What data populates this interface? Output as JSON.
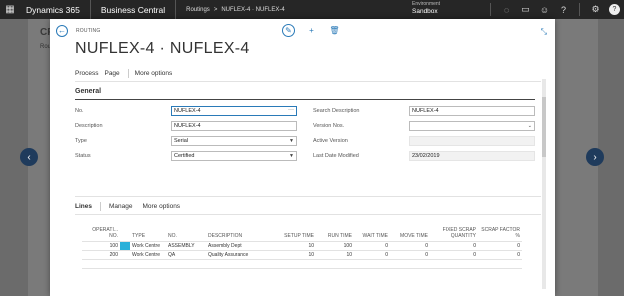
{
  "topbar": {
    "brand": "Dynamics 365",
    "app": "Business Central",
    "breadcrumb": [
      "Routings",
      ">",
      "NUFLEX-4 · NUFLEX-4"
    ],
    "environment_label": "Environment",
    "environment_value": "Sandbox",
    "icons": [
      "lightbulb-icon",
      "chat-icon",
      "smiley-icon",
      "help-icon",
      "settings-icon"
    ],
    "user_initial": "?"
  },
  "background": {
    "title": "CR",
    "sub": "Rou"
  },
  "dialog": {
    "breadcrumb": "ROUTING",
    "title": "NUFLEX-4 · NUFLEX-4",
    "actions": [
      "Process",
      "Page",
      "More options"
    ],
    "general": {
      "heading": "General",
      "fields": {
        "no": {
          "label": "No.",
          "value": "NUFLEX-4"
        },
        "description": {
          "label": "Description",
          "value": "NUFLEX-4"
        },
        "type": {
          "label": "Type",
          "value": "Serial"
        },
        "status": {
          "label": "Status",
          "value": "Certified"
        },
        "search_description": {
          "label": "Search Description",
          "value": "NUFLEX-4"
        },
        "version_nos": {
          "label": "Version Nos.",
          "value": ""
        },
        "active_version": {
          "label": "Active Version",
          "value": ""
        },
        "last_date_modified": {
          "label": "Last Date Modified",
          "value": "23/02/2019"
        }
      }
    },
    "lines": {
      "heading": "Lines",
      "actions": [
        "Manage",
        "More options"
      ],
      "columns": [
        "OPERATI... NO.",
        "TYPE",
        "NO.",
        "DESCRIPTION",
        "SETUP TIME",
        "RUN TIME",
        "WAIT TIME",
        "MOVE TIME",
        "FIXED SCRAP QUANTITY",
        "SCRAP FACTOR %"
      ],
      "rows": [
        [
          "100",
          "Work Centre",
          "ASSEMBLY",
          "Assembly Dept",
          "10",
          "100",
          "0",
          "0",
          "0",
          "0"
        ],
        [
          "200",
          "Work Centre",
          "QA",
          "Quality Assurance",
          "10",
          "10",
          "0",
          "0",
          "0",
          "0"
        ]
      ]
    }
  }
}
